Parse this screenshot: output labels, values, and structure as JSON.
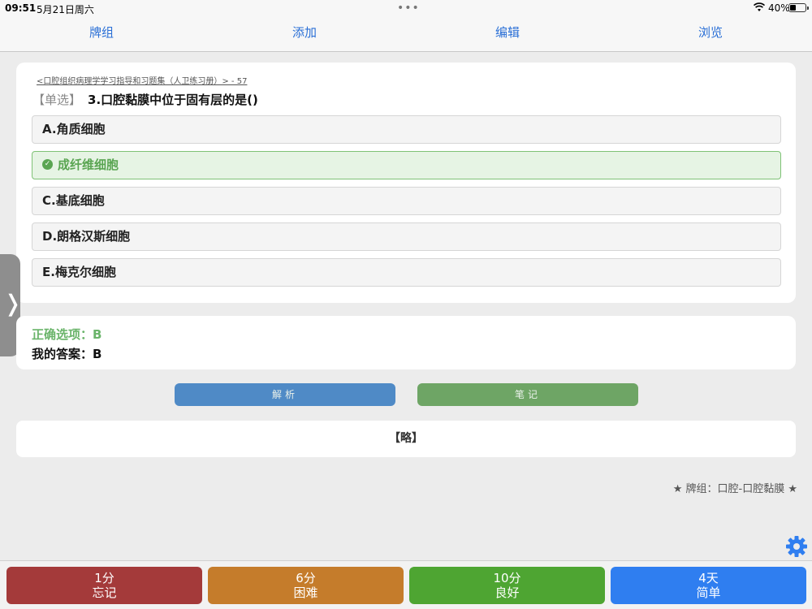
{
  "status": {
    "time": "09:51",
    "date": "5月21日周六",
    "dots": "•••",
    "battery_text": "40%",
    "battery_level": 0.4
  },
  "nav": {
    "items": [
      "牌组",
      "添加",
      "编辑",
      "浏览"
    ],
    "color": "#2a6fd6"
  },
  "question": {
    "source": "<口腔组织病理学学习指导和习题集（人卫练习册）> - 57",
    "type": "【单选】",
    "text": "3.口腔黏膜中位于固有层的是()",
    "options": [
      "A.角质细胞",
      "成纤维细胞",
      "C.基底细胞",
      "D.朗格汉斯细胞",
      "E.梅克尔细胞"
    ],
    "correct_index": 1
  },
  "answer": {
    "correct": "正确选项：B",
    "mine": "我的答案：B"
  },
  "buttons": {
    "analysis": "解析",
    "notes": "笔记"
  },
  "omitted": "【略】",
  "deck": "★ 牌组：口腔-口腔黏膜 ★",
  "ratings": [
    {
      "time": "1分",
      "label": "忘记",
      "color": "#a43a3a"
    },
    {
      "time": "6分",
      "label": "困难",
      "color": "#c57c2b"
    },
    {
      "time": "10分",
      "label": "良好",
      "color": "#4ea532"
    },
    {
      "time": "4天",
      "label": "简单",
      "color": "#2f7ef0"
    }
  ],
  "icons": {
    "side_handle": "chevron-right-icon",
    "settings": "gear-icon",
    "wifi": "wifi-icon",
    "check": "checkmark-icon"
  }
}
